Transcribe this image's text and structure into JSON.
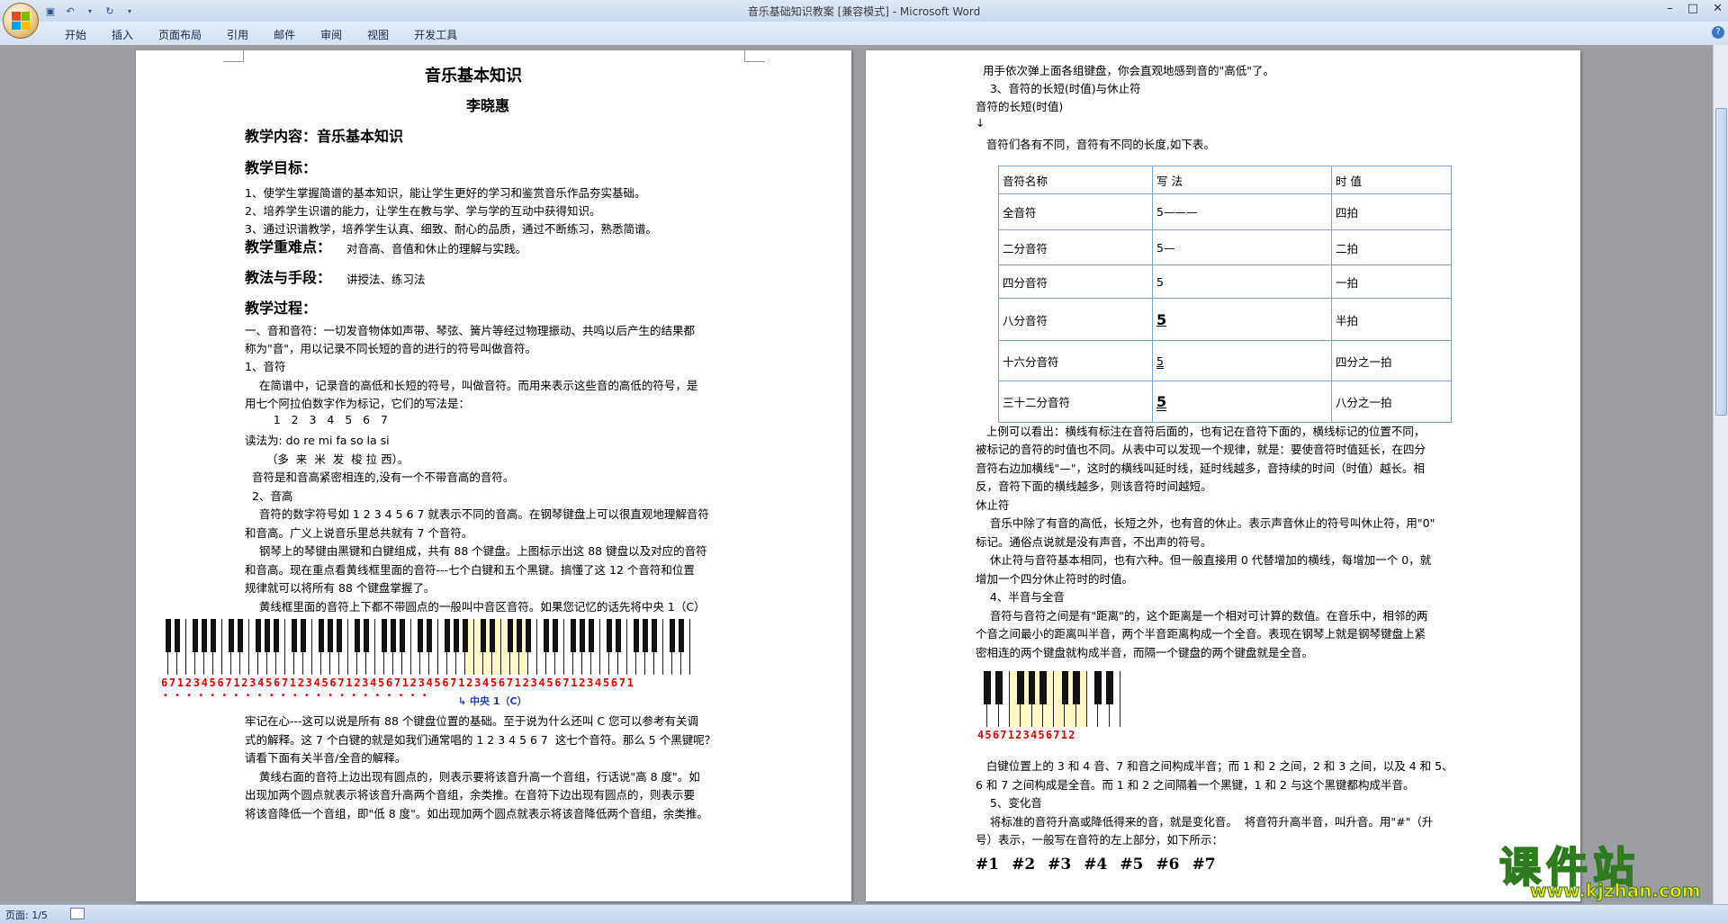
{
  "window": {
    "title": "音乐基础知识教案 [兼容模式] - Microsoft Word"
  },
  "ribbon": {
    "tabs": [
      "开始",
      "插入",
      "页面布局",
      "引用",
      "邮件",
      "审阅",
      "视图",
      "开发工具"
    ]
  },
  "status": {
    "page": "页面: 1/5"
  },
  "page1": {
    "title": "音乐基本知识",
    "author": "李晓惠",
    "content_heading": "教学内容：音乐基本知识",
    "goals_heading": "教学目标：",
    "goals": [
      "1、使学生掌握简谱的基本知识，能让学生更好的学习和鉴赏音乐作品夯实基础。",
      "2、培养学生识谱的能力，让学生在教与学、学与学的互动中获得知识。",
      "3、通过识谱教学，培养学生认真、细致、耐心的品质，通过不断练习，熟悉简谱。"
    ],
    "difficulty_heading": "教学重难点：",
    "difficulty_text": "对音高、音值和休止的理解与实践。",
    "method_heading": "教法与手段：",
    "method_text": "讲授法、练习法",
    "process_heading": "教学过程：",
    "lines": [
      "一、音和音符：一切发音物体如声带、琴弦、簧片等经过物理振动、共鸣以后产生的结果都",
      "称为\"音\"，用以记录不同长短的音的进行的符号叫做音符。",
      "1、音符",
      "    在简谱中，记录音的高低和长短的符号，叫做音符。而用来表示这些音的高低的符号，是",
      "用七个阿拉伯数字作为标记，它们的写法是：",
      "        1   2   3   4   5   6   7",
      "读法为: do re mi fa so la si",
      "      （多  来  米  发  梭 拉 西）。",
      "  音符是和音高紧密相连的,没有一个不带音高的音符。",
      "  2、音高",
      "    音符的数字符号如 1 2 3 4 5 6 7 就表示不同的音高。在钢琴键盘上可以很直观地理解音符",
      "和音高。广义上说音乐里总共就有 7 个音符。",
      "    钢琴上的琴键由黑键和白键组成，共有 88 个键盘。上图标示出这 88 键盘以及对应的音符",
      "和音高。现在重点看黄线框里面的音符---七个白键和五个黑键。搞懂了这 12 个音符和位置",
      "规律就可以将所有 88 个键盘掌握了。",
      "    黄线框里面的音符上下都不带圆点的一般叫中音区音符。如果您记忆的话先将中央 1（C）"
    ],
    "after_keyboard": [
      "牢记在心---这可以说是所有 88 个键盘位置的基础。至于说为什么还叫 C 您可以参考有关调",
      "式的解释。这 7 个白键的就是如我们通常唱的 1 2 3 4 5 6 7  这七个音符。那么 5 个黑键呢？",
      "请看下面有关半音/全音的解释。",
      "    黄线右面的音符上边出现有圆点的，则表示要将该音升高一个音组，行话说\"高 8 度\"。如",
      "出现加两个圆点就表示将该音升高两个音组，余类推。在音符下边出现有圆点的，则表示要",
      "将该音降低一个音组，即\"低 8 度\"。如出现加两个圆点就表示将该音降低两个音组，余类推。"
    ],
    "keyboard_caption": "中央 1（C）",
    "keyboard_numbers": "67123456712345671234567123456712345671234567123456712345671"
  },
  "page2": {
    "top_lines": [
      "  用手依次弹上面各组键盘，你会直观地感到音的\"高低\"了。",
      "    3、音符的长短(时值)与休止符",
      "音符的长短(时值)",
      "",
      "   音符们各有不同，音符有不同的长度,如下表。"
    ],
    "table": {
      "headers": [
        "音符名称",
        "写 法",
        "时 值"
      ],
      "rows": [
        [
          "全音符",
          "5———",
          "四拍"
        ],
        [
          "二分音符",
          "5—",
          "二拍"
        ],
        [
          "四分音符",
          "5",
          "一拍"
        ],
        [
          "八分音符",
          "5",
          "半拍"
        ],
        [
          "十六分音符",
          "5",
          "四分之一拍"
        ],
        [
          "三十二分音符",
          "5",
          "八分之一拍"
        ]
      ]
    },
    "mid_lines": [
      "   上例可以看出：横线有标注在音符后面的，也有记在音符下面的，横线标记的位置不同，",
      "被标记的音符的时值也不同。从表中可以发现一个规律，就是：要使音符时值延长，在四分",
      "音符右边加横线\"—\"，这时的横线叫延时线，延时线越多，音持续的时间（时值）越长。相",
      "反，音符下面的横线越多，则该音符时间越短。",
      "休止符",
      "    音乐中除了有音的高低，长短之外，也有音的休止。表示声音休止的符号叫休止符，用\"0\"",
      "标记。通俗点说就是没有声音，不出声的符号。",
      "    休止符与音符基本相同，也有六种。但一般直接用 0 代替增加的横线，每增加一个 0，就",
      "增加一个四分休止符时的时值。",
      "    4、半音与全音",
      "    音符与音符之间是有\"距离\"的，这个距离是一个相对可计算的数值。在音乐中，相邻的两",
      "个音之间最小的距离叫半音，两个半音距离构成一个全音。表现在钢琴上就是钢琴键盘上紧",
      "密相连的两个键盘就构成半音，而隔一个键盘的两个键盘就是全音。"
    ],
    "keyboard_numbers": "4567123456712",
    "bottom_lines": [
      "   白键位置上的 3 和 4 音、7 和音之间构成半音；而 1 和 2 之间，2 和 3 之间，以及 4 和 5、",
      "6 和 7 之间构成是全音。而 1 和 2 之间隔着一个黑键，1 和 2 与这个黑键都构成半音。",
      "    5、变化音",
      "    将标准的音符升高或降低得来的音，就是变化音。  将音符升高半音，叫升音。用\"#\"（升",
      "号）表示，一般写在音符的左上部分，如下所示："
    ],
    "sharps": [
      "#1",
      "#2",
      "#3",
      "#4",
      "#5",
      "#6",
      "#7"
    ]
  },
  "watermark": {
    "text": "课件站",
    "url": "www.kjzhan.com"
  },
  "colors": {
    "title_bar_text": "#3b3b3b",
    "word_blue": "#2b5797",
    "table_border": "#7da2d6",
    "keyboard_red": "#e00000",
    "highlight_yellow": "#fff096",
    "watermark_yellow": "#f5e400"
  }
}
